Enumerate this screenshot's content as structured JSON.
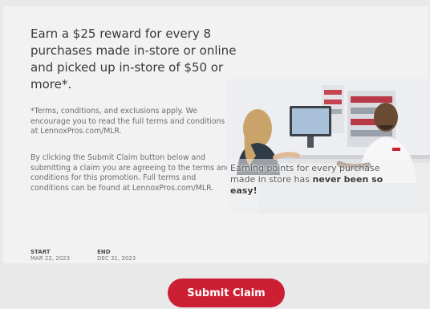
{
  "promo": {
    "headline": "Earn a $25 reward for every 8 purchases made in-store or online and picked up in-store of $50 or more*.",
    "terms": "*Terms, conditions, and exclusions apply. We encourage you to read the full terms and conditions at LennoxPros.com/MLR.",
    "clicking": "By clicking the Submit Claim button below and submitting a claim you are agreeing to the terms and conditions for this promotion. Full terms and conditions can be found at LennoxPros.com/MLR.",
    "caption_normal": "Earning points for every purchase made in store has",
    "caption_strong": "never been so easy!"
  },
  "dates": {
    "start_label": "START",
    "start_value": "MAR 22, 2023",
    "end_label": "END",
    "end_value": "DEC 31, 2023"
  },
  "actions": {
    "submit_label": "Submit Claim"
  },
  "colors": {
    "accent": "#cc1f34",
    "card_bg": "#f2f2f2",
    "page_bg": "#e9e9e9"
  }
}
